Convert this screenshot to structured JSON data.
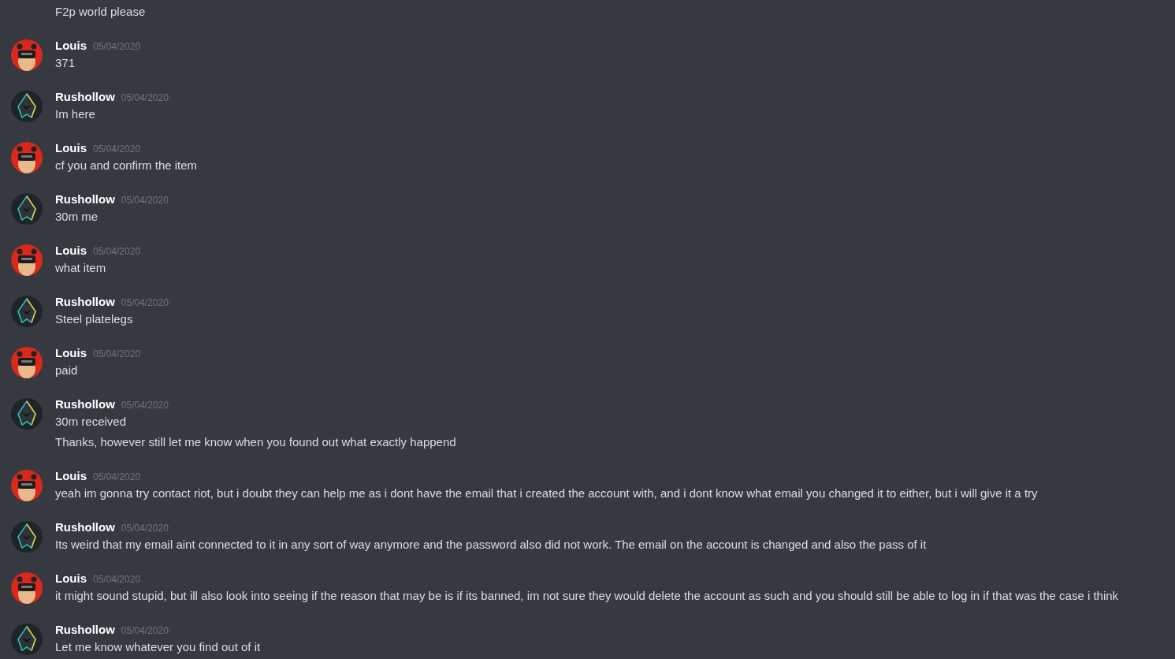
{
  "messages": [
    {
      "kind": "continuation",
      "lines": [
        "F2p world please"
      ]
    },
    {
      "kind": "group",
      "author": "Louis",
      "date": "05/04/2020",
      "avatar": {
        "kind": "mask"
      },
      "lines": [
        "371"
      ]
    },
    {
      "kind": "group",
      "author": "Rushollow",
      "date": "05/04/2020",
      "avatar": {
        "kind": "hood"
      },
      "lines": [
        "Im here"
      ]
    },
    {
      "kind": "group",
      "author": "Louis",
      "date": "05/04/2020",
      "avatar": {
        "kind": "mask"
      },
      "lines": [
        "cf you and confirm the item"
      ]
    },
    {
      "kind": "group",
      "author": "Rushollow",
      "date": "05/04/2020",
      "avatar": {
        "kind": "hood"
      },
      "lines": [
        "30m me"
      ]
    },
    {
      "kind": "group",
      "author": "Louis",
      "date": "05/04/2020",
      "avatar": {
        "kind": "mask"
      },
      "lines": [
        "what item"
      ]
    },
    {
      "kind": "group",
      "author": "Rushollow",
      "date": "05/04/2020",
      "avatar": {
        "kind": "hood"
      },
      "lines": [
        "Steel platelegs"
      ]
    },
    {
      "kind": "group",
      "author": "Louis",
      "date": "05/04/2020",
      "avatar": {
        "kind": "mask"
      },
      "lines": [
        "paid"
      ]
    },
    {
      "kind": "group",
      "author": "Rushollow",
      "date": "05/04/2020",
      "avatar": {
        "kind": "hood"
      },
      "lines": [
        "30m received",
        "Thanks, however still let me know when you found out what exactly happend"
      ]
    },
    {
      "kind": "group",
      "author": "Louis",
      "date": "05/04/2020",
      "avatar": {
        "kind": "mask"
      },
      "lines": [
        "yeah im gonna try contact riot, but i doubt they can help me as i dont have the email that i created the account with, and i dont know what email you changed it to either, but i will give it a try"
      ]
    },
    {
      "kind": "group",
      "author": "Rushollow",
      "date": "05/04/2020",
      "avatar": {
        "kind": "hood"
      },
      "lines": [
        "Its weird that my email aint connected to it in any sort of way anymore and the password also did not work. The email on the account is changed and also the pass of it"
      ]
    },
    {
      "kind": "group",
      "author": "Louis",
      "date": "05/04/2020",
      "avatar": {
        "kind": "mask"
      },
      "lines": [
        "it might sound stupid, but ill also look into seeing if the reason that may be is if its banned, im not sure they would delete the account as such and you should still be able to log in if that was the case i think"
      ]
    },
    {
      "kind": "group",
      "author": "Rushollow",
      "date": "05/04/2020",
      "avatar": {
        "kind": "hood"
      },
      "lines": [
        "Let me know whatever you find out of it"
      ]
    }
  ]
}
